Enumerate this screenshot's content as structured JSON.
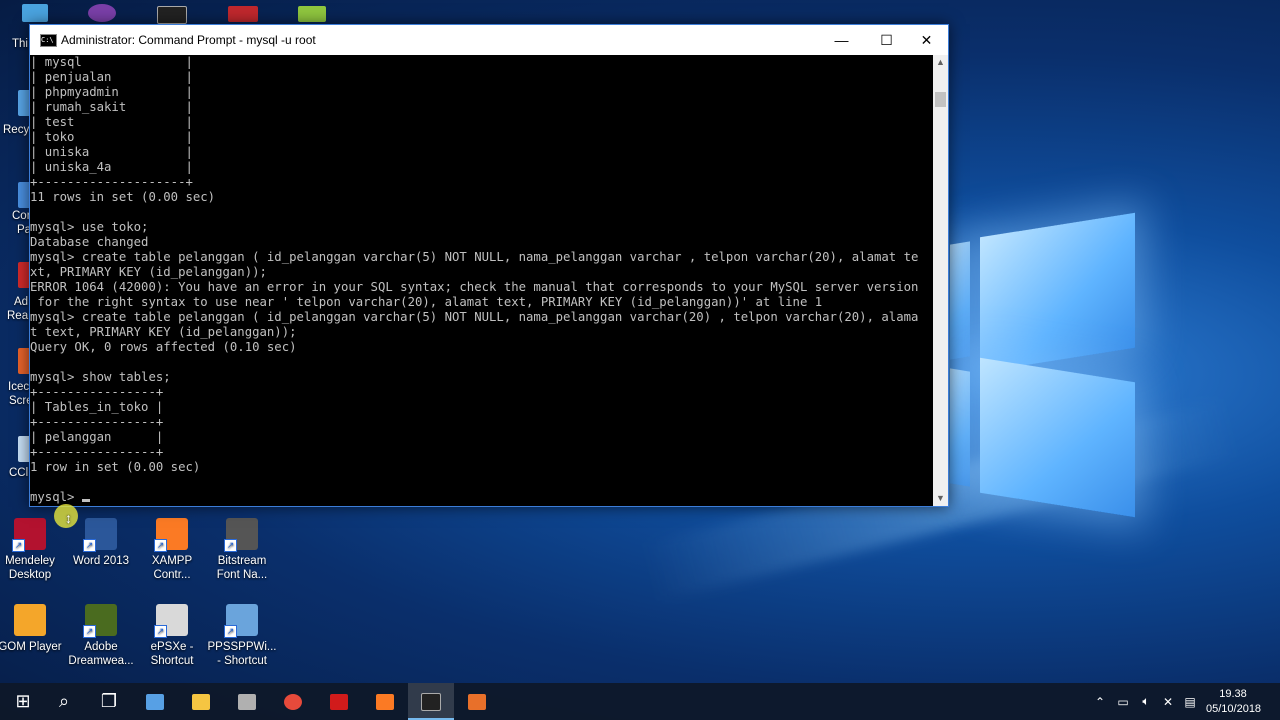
{
  "window": {
    "title": "Administrator: Command Prompt - mysql  -u root",
    "app_icon_text": "C:\\",
    "minimize_glyph": "—",
    "maximize_glyph": "☐",
    "close_glyph": "✕"
  },
  "console_lines": [
    "| mysql              |",
    "| penjualan          |",
    "| phpmyadmin         |",
    "| rumah_sakit        |",
    "| test               |",
    "| toko               |",
    "| uniska             |",
    "| uniska_4a          |",
    "+--------------------+",
    "11 rows in set (0.00 sec)",
    "",
    "mysql> use toko;",
    "Database changed",
    "mysql> create table pelanggan ( id_pelanggan varchar(5) NOT NULL, nama_pelanggan varchar , telpon varchar(20), alamat te",
    "xt, PRIMARY KEY (id_pelanggan));",
    "ERROR 1064 (42000): You have an error in your SQL syntax; check the manual that corresponds to your MySQL server version",
    " for the right syntax to use near ' telpon varchar(20), alamat text, PRIMARY KEY (id_pelanggan))' at line 1",
    "mysql> create table pelanggan ( id_pelanggan varchar(5) NOT NULL, nama_pelanggan varchar(20) , telpon varchar(20), alama",
    "t text, PRIMARY KEY (id_pelanggan));",
    "Query OK, 0 rows affected (0.10 sec)",
    "",
    "mysql> show tables;",
    "+----------------+",
    "| Tables_in_toko |",
    "+----------------+",
    "| pelanggan      |",
    "+----------------+",
    "1 row in set (0.00 sec)",
    "",
    "mysql> "
  ],
  "desktop_icons": [
    {
      "label": "Mendeley Desktop",
      "color": "#b3122f"
    },
    {
      "label": "Word 2013",
      "color": "#2b579a"
    },
    {
      "label": "XAMPP Contr...",
      "color": "#fb7a24"
    },
    {
      "label": "Bitstream Font Na...",
      "color": "#555555"
    },
    {
      "label": "GOM Player",
      "color": "#f4a62a"
    },
    {
      "label": "Adobe Dreamwea...",
      "color": "#4a6b1f"
    },
    {
      "label": "ePSXe - Shortcut",
      "color": "#d9d9d9"
    },
    {
      "label": "PPSSPPWi... - Shortcut",
      "color": "#6aa4dc"
    }
  ],
  "edge_labels": [
    "Thi",
    "Recy",
    "Cor",
    "Pa",
    "Ad",
    "Rea",
    "Icec",
    "Scre",
    "CCl"
  ],
  "taskbar": {
    "apps": [
      {
        "name": "start",
        "color": "#ffffff"
      },
      {
        "name": "search",
        "color": "#ffffff"
      },
      {
        "name": "task-view",
        "color": "#ffffff"
      },
      {
        "name": "store",
        "color": "#57a0e5"
      },
      {
        "name": "file-explorer",
        "color": "#f5c542"
      },
      {
        "name": "network",
        "color": "#b0b0b0"
      },
      {
        "name": "chrome",
        "color": "#e64a3b"
      },
      {
        "name": "acrobat",
        "color": "#d11b1b"
      },
      {
        "name": "xampp",
        "color": "#fb7a24"
      },
      {
        "name": "command-prompt",
        "color": "#222222"
      },
      {
        "name": "camtasia",
        "color": "#e8702a"
      }
    ],
    "time": "19.38",
    "date": "05/10/2018"
  }
}
